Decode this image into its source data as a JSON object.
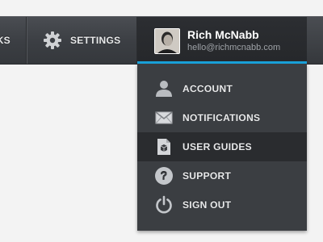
{
  "nav": {
    "partial_label": "KS",
    "settings_label": "SETTINGS"
  },
  "profile": {
    "name": "Rich McNabb",
    "email": "hello@richmcnabb.com"
  },
  "menu": {
    "items": [
      {
        "label": "ACCOUNT",
        "icon": "user-icon"
      },
      {
        "label": "NOTIFICATIONS",
        "icon": "envelope-icon"
      },
      {
        "label": "USER GUIDES",
        "icon": "document-icon",
        "active": true
      },
      {
        "label": "SUPPORT",
        "icon": "help-icon"
      },
      {
        "label": "SIGN OUT",
        "icon": "power-icon"
      }
    ]
  },
  "colors": {
    "accent": "#1aa3dc",
    "nav_bg": "#3b3e43",
    "dropdown_bg": "#3b3e42",
    "active_item_bg": "#2a2c2f"
  }
}
